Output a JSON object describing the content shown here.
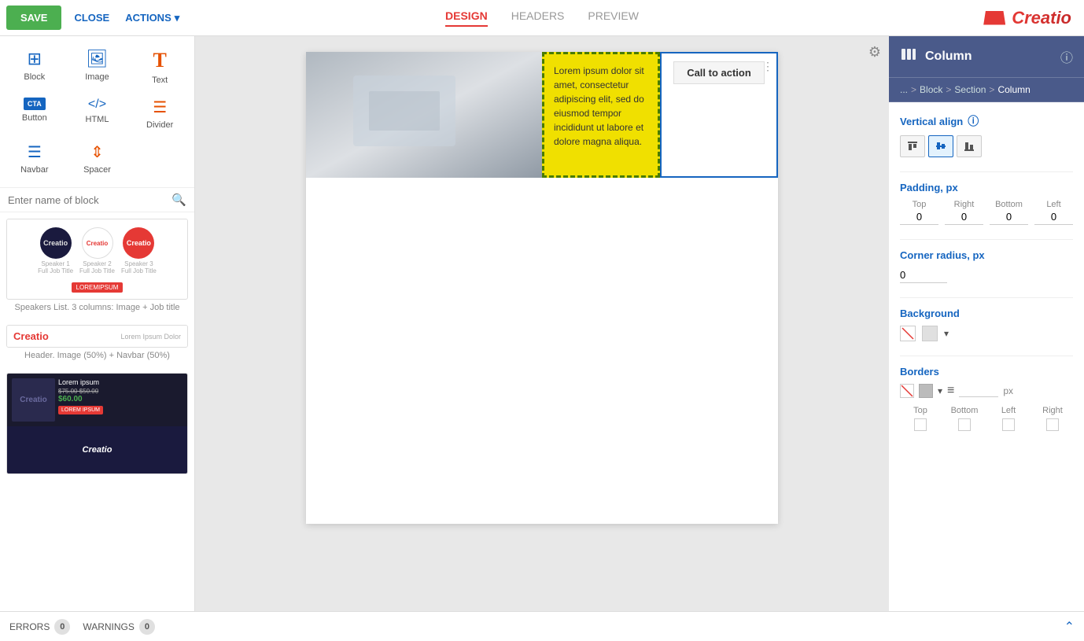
{
  "topbar": {
    "save_label": "SAVE",
    "close_label": "CLOSE",
    "actions_label": "ACTIONS",
    "tabs": [
      {
        "id": "design",
        "label": "DESIGN",
        "active": true
      },
      {
        "id": "headers",
        "label": "HEADERS",
        "active": false
      },
      {
        "id": "preview",
        "label": "PREVIEW",
        "active": false
      }
    ],
    "logo": "Creatio"
  },
  "left_sidebar": {
    "blocks": [
      {
        "id": "block",
        "label": "Block",
        "icon": "⊞"
      },
      {
        "id": "image",
        "label": "Image",
        "icon": "🖼"
      },
      {
        "id": "text",
        "label": "Text",
        "icon": "T"
      },
      {
        "id": "button",
        "label": "Button",
        "icon": "CTA"
      },
      {
        "id": "html",
        "label": "HTML",
        "icon": "</>"
      },
      {
        "id": "divider",
        "label": "Divider",
        "icon": "—"
      },
      {
        "id": "navbar",
        "label": "Navbar",
        "icon": "≡"
      },
      {
        "id": "spacer",
        "label": "Spacer",
        "icon": "↕"
      }
    ],
    "search_placeholder": "Enter name of block",
    "templates": [
      {
        "id": "speakers",
        "label": "Speakers List. 3 columns: Image + Job title"
      },
      {
        "id": "header-navbar",
        "label": "Header. Image (50%) + Navbar (50%)"
      },
      {
        "id": "product",
        "label": ""
      }
    ]
  },
  "canvas": {
    "cta_label": "Call to action",
    "lorem_text": "Lorem ipsum dolor sit amet, consectetur adipiscing elit, sed do eiusmod tempor incididunt ut labore et dolore magna aliqua.",
    "gear_icon": "⚙"
  },
  "right_panel": {
    "header": {
      "icon": "|||",
      "title": "Column",
      "info_icon": "ⓘ"
    },
    "breadcrumb": {
      "items": [
        "...",
        "Block",
        "Section",
        "Column"
      ],
      "separators": [
        ">",
        ">",
        ">"
      ]
    },
    "vertical_align": {
      "label": "Vertical align",
      "info_icon": "ⓘ",
      "options": [
        "top",
        "middle",
        "bottom"
      ]
    },
    "padding": {
      "label": "Padding, px",
      "fields": [
        {
          "id": "top",
          "label": "Top",
          "value": "0"
        },
        {
          "id": "right",
          "label": "Right",
          "value": "0"
        },
        {
          "id": "bottom",
          "label": "Bottom",
          "value": "0"
        },
        {
          "id": "left",
          "label": "Left",
          "value": "0"
        }
      ]
    },
    "corner_radius": {
      "label": "Corner radius, px",
      "value": "0"
    },
    "background": {
      "label": "Background"
    },
    "borders": {
      "label": "Borders",
      "width_placeholder": "",
      "px_label": "px",
      "sides": [
        "Top",
        "Bottom",
        "Left",
        "Right"
      ]
    }
  },
  "errors_bar": {
    "errors_label": "ERRORS",
    "errors_count": "0",
    "warnings_label": "WARNINGS",
    "warnings_count": "0"
  }
}
